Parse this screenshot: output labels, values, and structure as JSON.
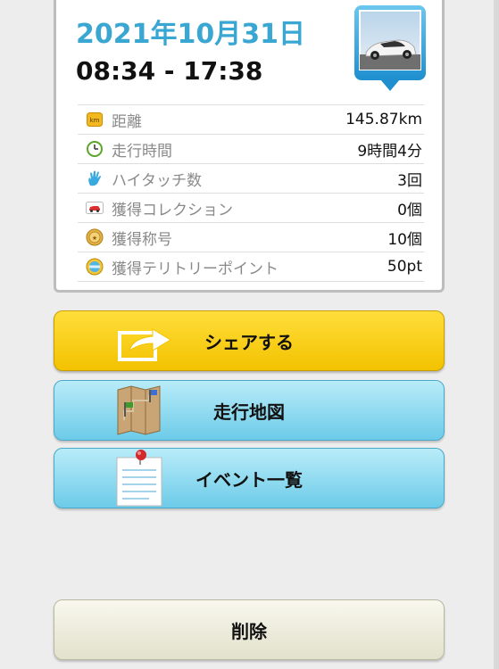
{
  "trip": {
    "date": "2021年10月31日",
    "time_range": "08:34 - 17:38"
  },
  "stats": [
    {
      "icon": "km-badge-icon",
      "label": "距離",
      "value": "145.87km"
    },
    {
      "icon": "clock-icon",
      "label": "走行時間",
      "value": "9時間4分"
    },
    {
      "icon": "high-five-hand-icon",
      "label": "ハイタッチ数",
      "value": "3回"
    },
    {
      "icon": "car-card-icon",
      "label": "獲得コレクション",
      "value": "0個"
    },
    {
      "icon": "gold-medal-icon",
      "label": "獲得称号",
      "value": "10個"
    },
    {
      "icon": "territory-point-icon",
      "label": "獲得テリトリーポイント",
      "value": "50pt"
    }
  ],
  "buttons": {
    "share": "シェアする",
    "map": "走行地図",
    "events": "イベント一覧",
    "delete": "削除"
  },
  "colors": {
    "date_accent": "#3aa7d3",
    "share_button": "#f5c800",
    "map_button": "#8dd7ee",
    "delete_button": "#ecebd9"
  }
}
